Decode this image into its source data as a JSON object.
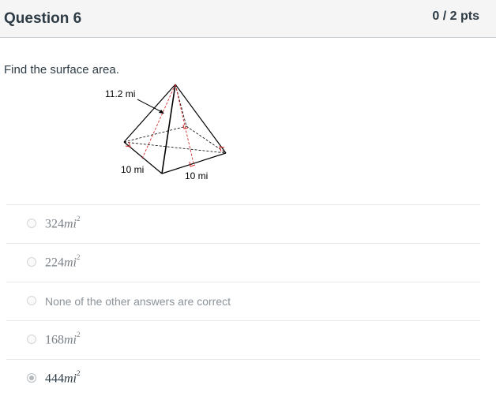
{
  "question": {
    "title": "Question 6",
    "points": "0 / 2 pts",
    "prompt": "Find the surface area."
  },
  "figure": {
    "slant_label": "11.2 mi",
    "base_label_left": "10 mi",
    "base_label_right": "10 mi"
  },
  "answers": [
    {
      "number": "324",
      "unit": "mi",
      "exponent": "2",
      "selected": false
    },
    {
      "number": "224",
      "unit": "mi",
      "exponent": "2",
      "selected": false
    },
    {
      "text": "None of the other answers are correct",
      "selected": false
    },
    {
      "number": "168",
      "unit": "mi",
      "exponent": "2",
      "selected": false
    },
    {
      "number": "444",
      "unit": "mi",
      "exponent": "2",
      "selected": true
    }
  ]
}
